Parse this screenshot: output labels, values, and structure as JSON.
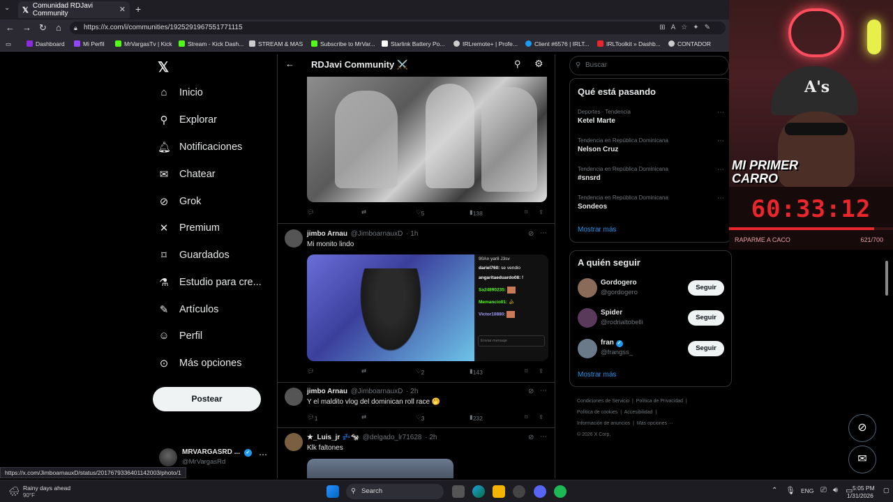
{
  "browser": {
    "tab_title": "Comunidad RDJavi Community",
    "url": "https://x.com/i/communities/1925291967551771115",
    "bookmarks": [
      {
        "label": "Dashboard",
        "color": "#8a2be2"
      },
      {
        "label": "Mi Perfil",
        "color": "#9146ff"
      },
      {
        "label": "MrVargasTv | Kick",
        "color": "#53fc18"
      },
      {
        "label": "Stream - Kick Dash...",
        "color": "#53fc18"
      },
      {
        "label": "STREAM & MAS",
        "color": "#cccccc"
      },
      {
        "label": "Subscribe to MrVar...",
        "color": "#53fc18"
      },
      {
        "label": "Starlink Battery Po...",
        "color": "#ffffff"
      },
      {
        "label": "IRLremote+ | Profe...",
        "color": "#cccccc"
      },
      {
        "label": "Client #6576 | IRLT...",
        "color": "#1d9bf0"
      },
      {
        "label": "IRLToolkit » Dashb...",
        "color": "#e8262c"
      },
      {
        "label": "CONTADOR",
        "color": "#cccccc"
      }
    ],
    "status_url": "https://x.com/JimboarnauxD/status/2017679336401142003/photo/1"
  },
  "sidebar": {
    "items": [
      {
        "label": "Inicio",
        "icon": "home-icon",
        "glyph": "⌂"
      },
      {
        "label": "Explorar",
        "icon": "search-icon",
        "glyph": "⚲"
      },
      {
        "label": "Notificaciones",
        "icon": "bell-icon",
        "glyph": "♫"
      },
      {
        "label": "Chatear",
        "icon": "mail-icon",
        "glyph": "✉"
      },
      {
        "label": "Grok",
        "icon": "grok-icon",
        "glyph": "⊘"
      },
      {
        "label": "Premium",
        "icon": "x-icon",
        "glyph": "✕"
      },
      {
        "label": "Guardados",
        "icon": "bookmark-icon",
        "glyph": "⌑"
      },
      {
        "label": "Estudio para cre...",
        "icon": "studio-icon",
        "glyph": "⚗"
      },
      {
        "label": "Artículos",
        "icon": "article-icon",
        "glyph": "✎"
      },
      {
        "label": "Perfil",
        "icon": "person-icon",
        "glyph": "☺"
      },
      {
        "label": "Más opciones",
        "icon": "more-icon",
        "glyph": "⋯"
      }
    ],
    "post_button": "Postear",
    "account": {
      "name": "MRVARGASRD ...",
      "handle": "@MrVargasRd"
    }
  },
  "main": {
    "title": "RDJavi Community ⚔️",
    "first_post_stats": {
      "likes": "5",
      "views": "138"
    },
    "posts": [
      {
        "name": "jimbo Arnau",
        "handle": "@JimboarnauxD",
        "time": "· 1h",
        "text": "Mi monito lindo",
        "replies": "",
        "likes": "2",
        "views": "143"
      },
      {
        "name": "jimbo Arnau",
        "handle": "@JimboarnauxD",
        "time": "· 2h",
        "text": "Y el maldito vlog del dominican roll race 🤭",
        "replies": "1",
        "likes": "3",
        "views": "232"
      },
      {
        "name": "★_Luis_jr 💤🐄",
        "handle": "@delgado_lr71628",
        "time": "· 2h",
        "text": "Klk faltones"
      }
    ],
    "chat_overlay": [
      {
        "user": "dariel760:",
        "msg": "se vendio",
        "color": "#ffffff"
      },
      {
        "user": "angaritaeduardo08:",
        "msg": "f",
        "color": "#ffffff"
      },
      {
        "user": "Sa24890235:",
        "msg": "",
        "color": "#53fc18"
      },
      {
        "user": "Memancio01:",
        "msg": "",
        "color": "#53fc18"
      },
      {
        "user": "Victor10880:",
        "msg": "",
        "color": "#a0a0ff"
      }
    ],
    "chat_badges": "90An  yar8  J3sv",
    "chat_input": "Enviar mensaje"
  },
  "right": {
    "search_placeholder": "Buscar",
    "trends_title": "Qué está pasando",
    "trends": [
      {
        "category": "Deportes · Tendencia",
        "name": "Ketel Marte"
      },
      {
        "category": "Tendencia en República Dominicana",
        "name": "Nelson Cruz"
      },
      {
        "category": "Tendencia en República Dominicana",
        "name": "#snsrd"
      },
      {
        "category": "Tendencia en República Dominicana",
        "name": "Sondeos"
      }
    ],
    "show_more": "Mostrar más",
    "follow_title": "A quién seguir",
    "follow": [
      {
        "name": "Gordogero",
        "handle": "@gordogero",
        "button": "Seguir",
        "verified": false
      },
      {
        "name": "Spider",
        "handle": "@rodrialtobelli",
        "button": "Seguir",
        "verified": false
      },
      {
        "name": "fran",
        "handle": "@frangss_",
        "button": "Seguir",
        "verified": true
      }
    ],
    "footer": [
      "Condiciones de Servicio",
      "Política de Privacidad",
      "Política de cookies",
      "Accesibilidad",
      "Información de anuncios",
      "Más opciones ···",
      "© 2026 X Corp."
    ]
  },
  "stream_overlay": {
    "banner": "MI PRIMER CARRO",
    "timer": "60:33:12",
    "progress_label": "RAPARME A CACO",
    "progress_value": "621/700",
    "progress_fraction": 0.887
  },
  "taskbar": {
    "weather_title": "Rainy days ahead",
    "weather_temp": "90°F",
    "search": "Search",
    "lang": "ENG",
    "time": "5:05 PM",
    "date": "1/31/2026"
  }
}
